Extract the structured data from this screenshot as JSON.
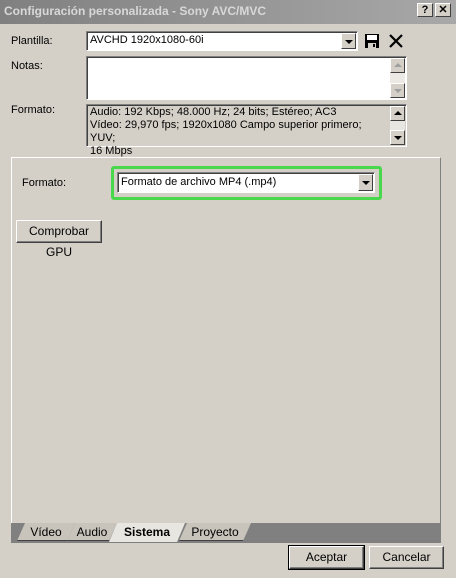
{
  "window": {
    "title": "Configuración personalizada - Sony AVC/MVC",
    "help_glyph": "?",
    "close_glyph": "✕"
  },
  "template": {
    "label": "Plantilla:",
    "value": "AVCHD 1920x1080-60i",
    "save_icon": "floppy-disk-icon",
    "delete_icon": "x-delete-icon"
  },
  "notes": {
    "label": "Notas:",
    "value": ""
  },
  "format_info": {
    "label": "Formato:",
    "lines": [
      "Audio: 192 Kbps; 48.000 Hz; 24 bits; Estéreo; AC3",
      "Vídeo: 29,970 fps; 1920x1080 Campo superior primero; YUV;",
      "16 Mbps"
    ]
  },
  "system_tab": {
    "format_label": "Formato:",
    "format_value": "Formato de archivo MP4 (.mp4)",
    "highlight_color": "#49d74c",
    "check_gpu_label": "Comprobar GPU"
  },
  "tabs": [
    {
      "label": "Vídeo",
      "active": false
    },
    {
      "label": "Audio",
      "active": false
    },
    {
      "label": "Sistema",
      "active": true
    },
    {
      "label": "Proyecto",
      "active": false
    }
  ],
  "footer": {
    "ok_label": "Aceptar",
    "cancel_label": "Cancelar"
  }
}
